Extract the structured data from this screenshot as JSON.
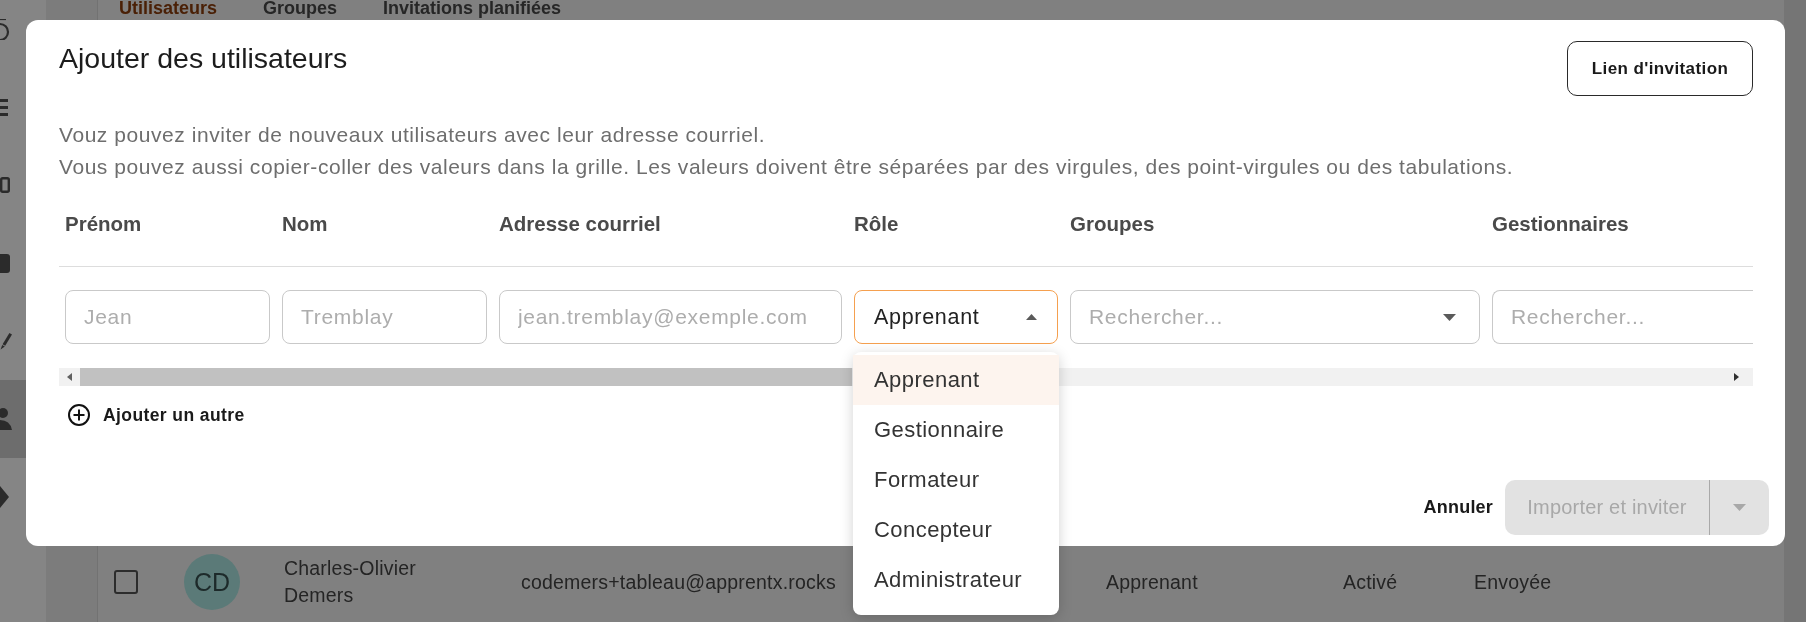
{
  "background_page": {
    "sidebar": {
      "items": [
        {
          "selected": false
        },
        {
          "selected": false
        },
        {
          "selected": false
        },
        {
          "selected": false
        },
        {
          "selected": false
        },
        {
          "selected": true
        },
        {
          "selected": false
        }
      ]
    },
    "tabs": [
      {
        "label": "Utilisateurs",
        "selected": true
      },
      {
        "label": "Groupes",
        "selected": false
      },
      {
        "label": "Invitations planifiées",
        "selected": false
      }
    ],
    "table_row": {
      "checked": false,
      "avatar": "CD",
      "cells": [
        "Charles-Olivier Demers",
        "codemers+tableau@apprentx.rocks",
        "Apprenant",
        "Activé",
        "Envoyée"
      ]
    }
  },
  "dialog": {
    "title": "Ajouter des utilisateurs",
    "invite_link_button": "Lien d'invitation",
    "description": [
      "Vouz pouvez inviter de nouveaux utilisateurs avec leur adresse courriel.",
      "Vous pouvez aussi copier-coller des valeurs dans la grille. Les valeurs doivent être séparées par des virgules, des point-virgules ou des tabulations."
    ],
    "columns": [
      "Prénom",
      "Nom",
      "Adresse courriel",
      "Rôle",
      "Groupes",
      "Gestionnaires"
    ],
    "fields": [
      {
        "kind": "text",
        "placeholder": "Jean"
      },
      {
        "kind": "text",
        "placeholder": "Tremblay"
      },
      {
        "kind": "text",
        "placeholder": "jean.tremblay@exemple.com"
      },
      {
        "kind": "select",
        "value": "Apprenant",
        "expanded": true,
        "options": [
          {
            "label": "Apprenant",
            "selected": true
          },
          {
            "label": "Gestionnaire",
            "selected": false
          },
          {
            "label": "Formateur",
            "selected": false
          },
          {
            "label": "Concepteur",
            "selected": false
          },
          {
            "label": "Administrateur",
            "selected": false
          }
        ]
      },
      {
        "kind": "select",
        "placeholder": "Rechercher...",
        "expanded": false
      },
      {
        "kind": "text",
        "placeholder": "Rechercher..."
      }
    ],
    "add_row_button": "Ajouter un autre",
    "cancel_button": "Annuler",
    "submit_button": {
      "label": "Importer et inviter",
      "disabled": true
    }
  }
}
